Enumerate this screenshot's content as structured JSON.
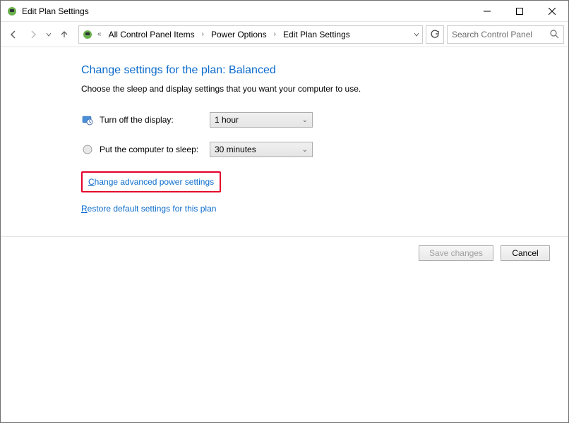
{
  "window": {
    "title": "Edit Plan Settings"
  },
  "breadcrumb": {
    "prefix": "«",
    "items": [
      "All Control Panel Items",
      "Power Options",
      "Edit Plan Settings"
    ]
  },
  "search": {
    "placeholder": "Search Control Panel"
  },
  "page": {
    "heading": "Change settings for the plan: Balanced",
    "subhead": "Choose the sleep and display settings that you want your computer to use."
  },
  "settings": {
    "display_label": "Turn off the display:",
    "display_value": "1 hour",
    "sleep_label": "Put the computer to sleep:",
    "sleep_value": "30 minutes"
  },
  "links": {
    "advanced_first": "C",
    "advanced_rest": "hange advanced power settings",
    "restore_first": "R",
    "restore_rest": "estore default settings for this plan"
  },
  "buttons": {
    "save": "Save changes",
    "cancel": "Cancel"
  }
}
